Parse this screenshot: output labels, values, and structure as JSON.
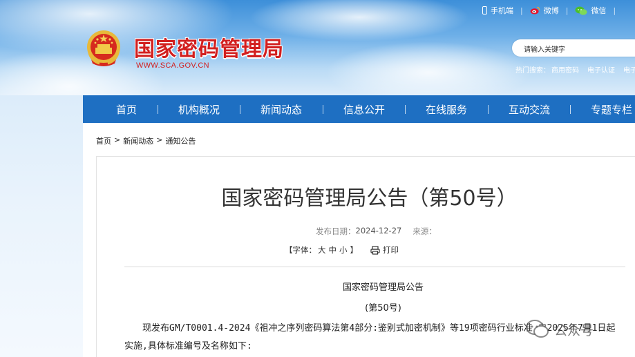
{
  "header": {
    "site_title": "国家密码管理局",
    "site_url": "WWW.SCA.GOV.CN",
    "top_links": {
      "mobile": "手机端",
      "weibo": "微博",
      "wechat": "微信"
    },
    "search": {
      "placeholder": "请输入关键字"
    },
    "hot_search": {
      "label": "热门搜索：",
      "items": [
        "商用密码",
        "电子认证",
        "电子"
      ]
    }
  },
  "nav": {
    "items": [
      "首页",
      "机构概况",
      "新闻动态",
      "信息公开",
      "在线服务",
      "互动交流",
      "专题专栏"
    ]
  },
  "breadcrumb": {
    "items": [
      "首页",
      "新闻动态",
      "通知公告"
    ],
    "separator": ">"
  },
  "article": {
    "title": "国家密码管理局公告（第50号）",
    "date_label": "发布日期：",
    "date_value": "2024-12-27",
    "source_label": "来源：",
    "font_tools": {
      "open": "【字体：",
      "large": "大",
      "medium": "中",
      "small": "小",
      "close": "】"
    },
    "print_label": "打印",
    "heading_1": "国家密码管理局公告",
    "heading_2": "(第50号)",
    "body": "现发布GM/T0001.4-2024《祖冲之序列密码算法第4部分:鉴别式加密机制》等19项密码行业标准,自2025年7月1日起实施,具体标准编号及名称如下:"
  },
  "watermark": {
    "text": "公众号",
    "dot": "•"
  },
  "colors": {
    "nav_bg": "#1e6fc2",
    "title_red": "#d21f1f",
    "sky_top": "#3d8fd9"
  }
}
